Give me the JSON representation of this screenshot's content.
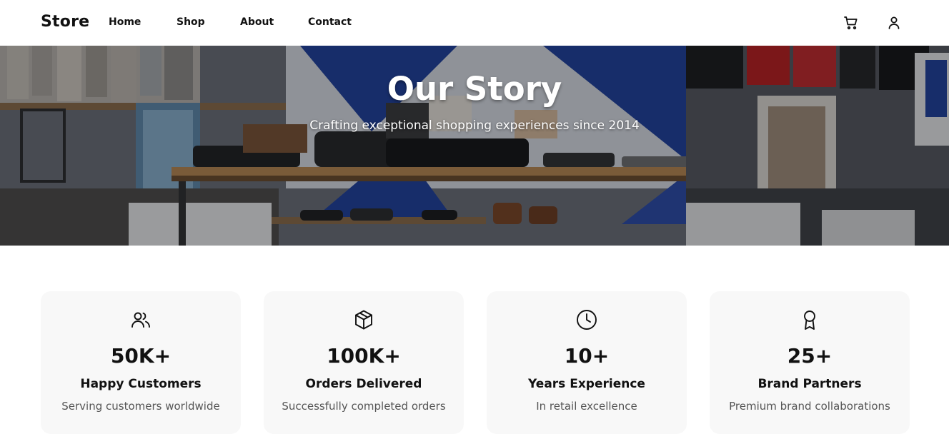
{
  "nav": {
    "brand": "Store",
    "links": [
      "Home",
      "Shop",
      "About",
      "Contact"
    ],
    "icons": {
      "cart": "cart-icon",
      "user": "user-icon"
    }
  },
  "hero": {
    "title": "Our Story",
    "subtitle": "Crafting exceptional shopping experiences since 2014"
  },
  "stats": [
    {
      "icon": "users-icon",
      "value": "50K+",
      "label": "Happy Customers",
      "desc": "Serving customers worldwide"
    },
    {
      "icon": "package-icon",
      "value": "100K+",
      "label": "Orders Delivered",
      "desc": "Successfully completed orders"
    },
    {
      "icon": "clock-icon",
      "value": "10+",
      "label": "Years Experience",
      "desc": "In retail excellence"
    },
    {
      "icon": "award-icon",
      "value": "25+",
      "label": "Brand Partners",
      "desc": "Premium brand collaborations"
    }
  ],
  "colors": {
    "text": "#111111",
    "muted": "#555555",
    "card_bg": "#f8f8f8",
    "accent_blue": "#1f3f9a"
  }
}
